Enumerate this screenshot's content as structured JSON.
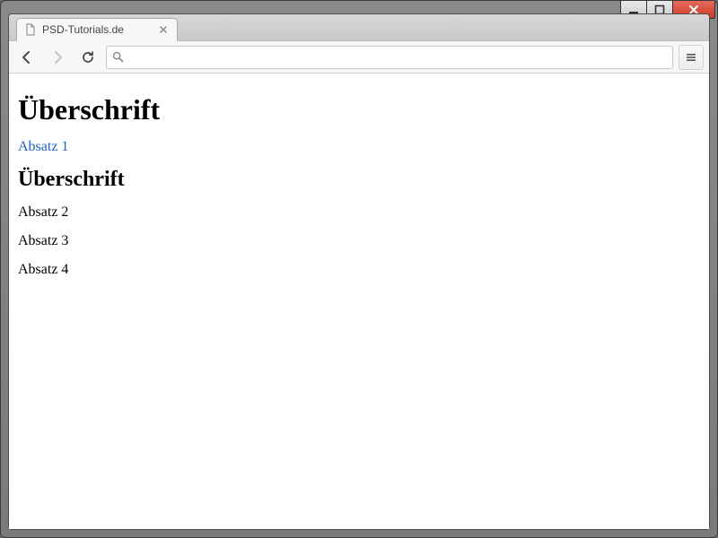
{
  "window": {
    "os": "windows-7"
  },
  "browser": {
    "name": "Google Chrome",
    "tab": {
      "title": "PSD-Tutorials.de"
    },
    "toolbar": {
      "back_enabled": true,
      "forward_enabled": false,
      "url_value": ""
    }
  },
  "page": {
    "h1": "Überschrift",
    "p1": "Absatz 1",
    "h2": "Überschrift",
    "p2": "Absatz 2",
    "p3": "Absatz 3",
    "p4": "Absatz 4"
  },
  "colors": {
    "link": "#1a5ed9",
    "window_close": "#cf3b25"
  }
}
